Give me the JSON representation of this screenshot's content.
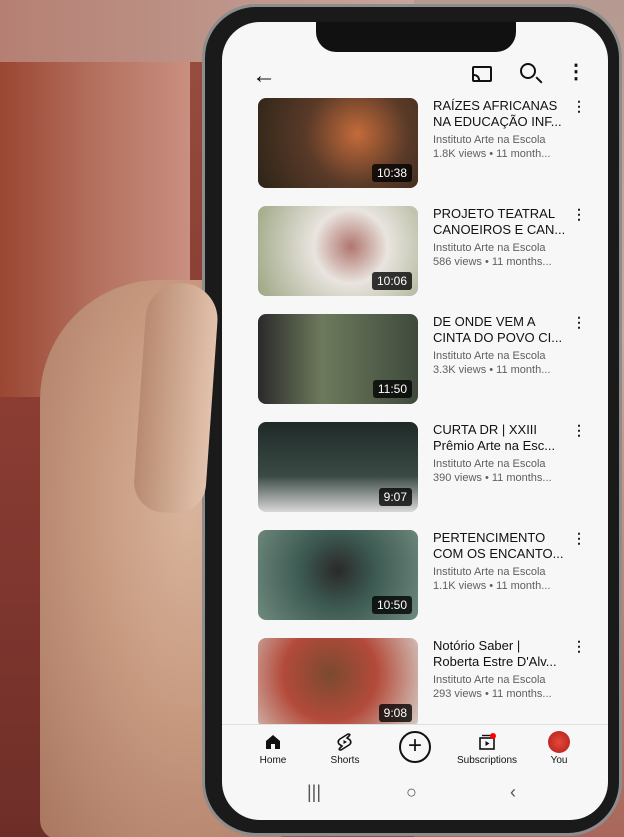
{
  "header": {
    "back_icon": "arrow-left-icon",
    "cast_icon": "cast-icon",
    "search_icon": "search-icon",
    "more_icon": "more-vertical-icon"
  },
  "videos": [
    {
      "title": "RAÍZES AFRICANAS NA EDUCAÇÃO INF...",
      "line1": "RAÍZES AFRICANAS",
      "line2": "NA EDUCAÇÃO INF...",
      "channel": "Instituto Arte na Escola",
      "views": "1.8K views • 11 month...",
      "duration": "10:38",
      "thumb_colors": [
        "#5a3a28",
        "#c46b3a",
        "#2d2418"
      ]
    },
    {
      "title": "PROJETO TEATRAL CANOEIROS E CAN...",
      "line1": "PROJETO TEATRAL",
      "line2": "CANOEIROS E CAN...",
      "channel": "Instituto Arte na Escola",
      "views": "586 views • 11 months...",
      "duration": "10:06",
      "thumb_colors": [
        "#9ca682",
        "#e9e4df",
        "#b0766e"
      ]
    },
    {
      "title": "DE ONDE VEM A CINTA DO POVO CI...",
      "line1": "DE ONDE VEM A",
      "line2": "CINTA DO POVO CI...",
      "channel": "Instituto Arte na Escola",
      "views": "3.3K views • 11 month...",
      "duration": "11:50",
      "thumb_colors": [
        "#3f4a3c",
        "#6d7a5c",
        "#2a2a2a"
      ]
    },
    {
      "title": "CURTA DR | XXIII Prêmio Arte na Esc...",
      "line1": "CURTA DR | XXIII",
      "line2": "Prêmio Arte na Esc...",
      "channel": "Instituto Arte na Escola",
      "views": "390 views • 11 months...",
      "duration": "9:07",
      "thumb_colors": [
        "#1f2a28",
        "#3b4a44",
        "#d8d8d8"
      ]
    },
    {
      "title": "PERTENCIMENTO COM OS ENCANTO...",
      "line1": "PERTENCIMENTO",
      "line2": "COM OS ENCANTO...",
      "channel": "Instituto Arte na Escola",
      "views": "1.1K views • 11 month...",
      "duration": "10:50",
      "thumb_colors": [
        "#3d5a52",
        "#6f8a7e",
        "#2a2a2a"
      ]
    },
    {
      "title": "Notório Saber | Roberta Estre D'Alv...",
      "line1": "Notório Saber |",
      "line2": "Roberta Estre D'Alv...",
      "channel": "Instituto Arte na Escola",
      "views": "293 views • 11 months...",
      "duration": "9:08",
      "thumb_colors": [
        "#b34a3a",
        "#7a4a30",
        "#d6cfc8"
      ]
    }
  ],
  "nav": {
    "home": "Home",
    "shorts": "Shorts",
    "create": "+",
    "subscriptions": "Subscriptions",
    "you": "You"
  },
  "sysnav": {
    "recent": "|||",
    "home": "○",
    "back": "‹"
  },
  "colors": {
    "accent": "#ff0000",
    "text": "#111111",
    "secondary": "#606060"
  }
}
